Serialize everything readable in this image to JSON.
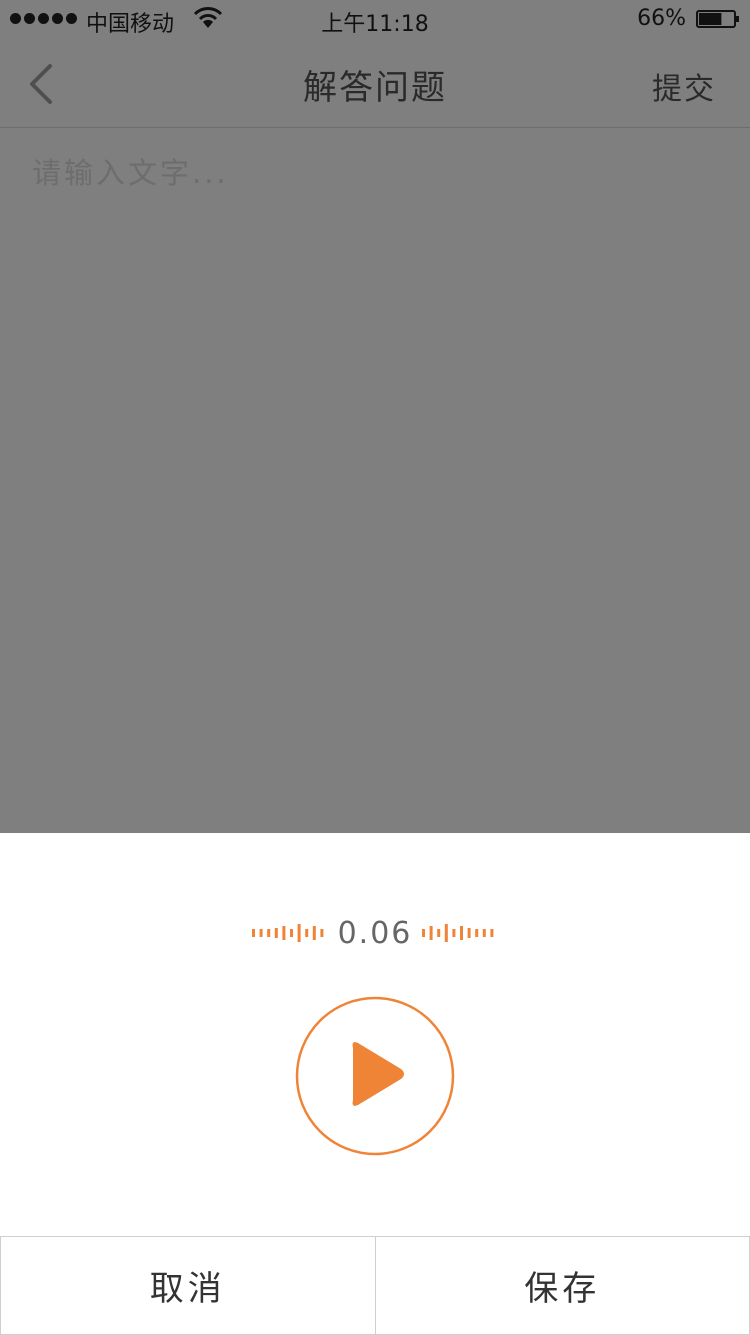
{
  "status_bar": {
    "carrier": "中国移动",
    "time": "上午11:18",
    "battery_percent": "66%",
    "battery_level": 0.66
  },
  "nav": {
    "title": "解答问题",
    "submit_label": "提交"
  },
  "editor": {
    "placeholder": "请输入文字..."
  },
  "recorder": {
    "duration": "0.06",
    "accent_color": "#F08436"
  },
  "actions": {
    "cancel_label": "取消",
    "save_label": "保存"
  }
}
